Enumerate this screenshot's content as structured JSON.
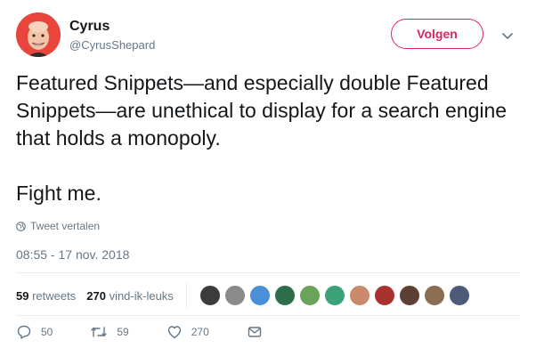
{
  "user": {
    "display_name": "Cyrus",
    "handle": "@CyrusShepard"
  },
  "follow_button_label": "Volgen",
  "tweet": {
    "paragraphs": [
      "Featured Snippets—and especially double Featured Snippets—are unethical to display for a search engine that holds a monopoly.",
      "Fight me."
    ]
  },
  "translate_label": "Tweet vertalen",
  "timestamp": "08:55 - 17 nov. 2018",
  "stats": {
    "retweets_count": "59",
    "retweets_label": "retweets",
    "likes_count": "270",
    "likes_label": "vind-ik-leuks"
  },
  "liker_avatar_colors": [
    "#3b3b3b",
    "#8a8a8a",
    "#4a8fd8",
    "#2c6e49",
    "#6aa35a",
    "#3aa37a",
    "#c98a6b",
    "#a8322d",
    "#5c4033",
    "#8b6d52",
    "#4d5b7a"
  ],
  "actions": {
    "reply_count": "50",
    "retweet_count": "59",
    "like_count": "270"
  },
  "colors": {
    "accent": "#e0245e",
    "secondary_text": "#657786",
    "avatar_bg": "#e8453c"
  }
}
